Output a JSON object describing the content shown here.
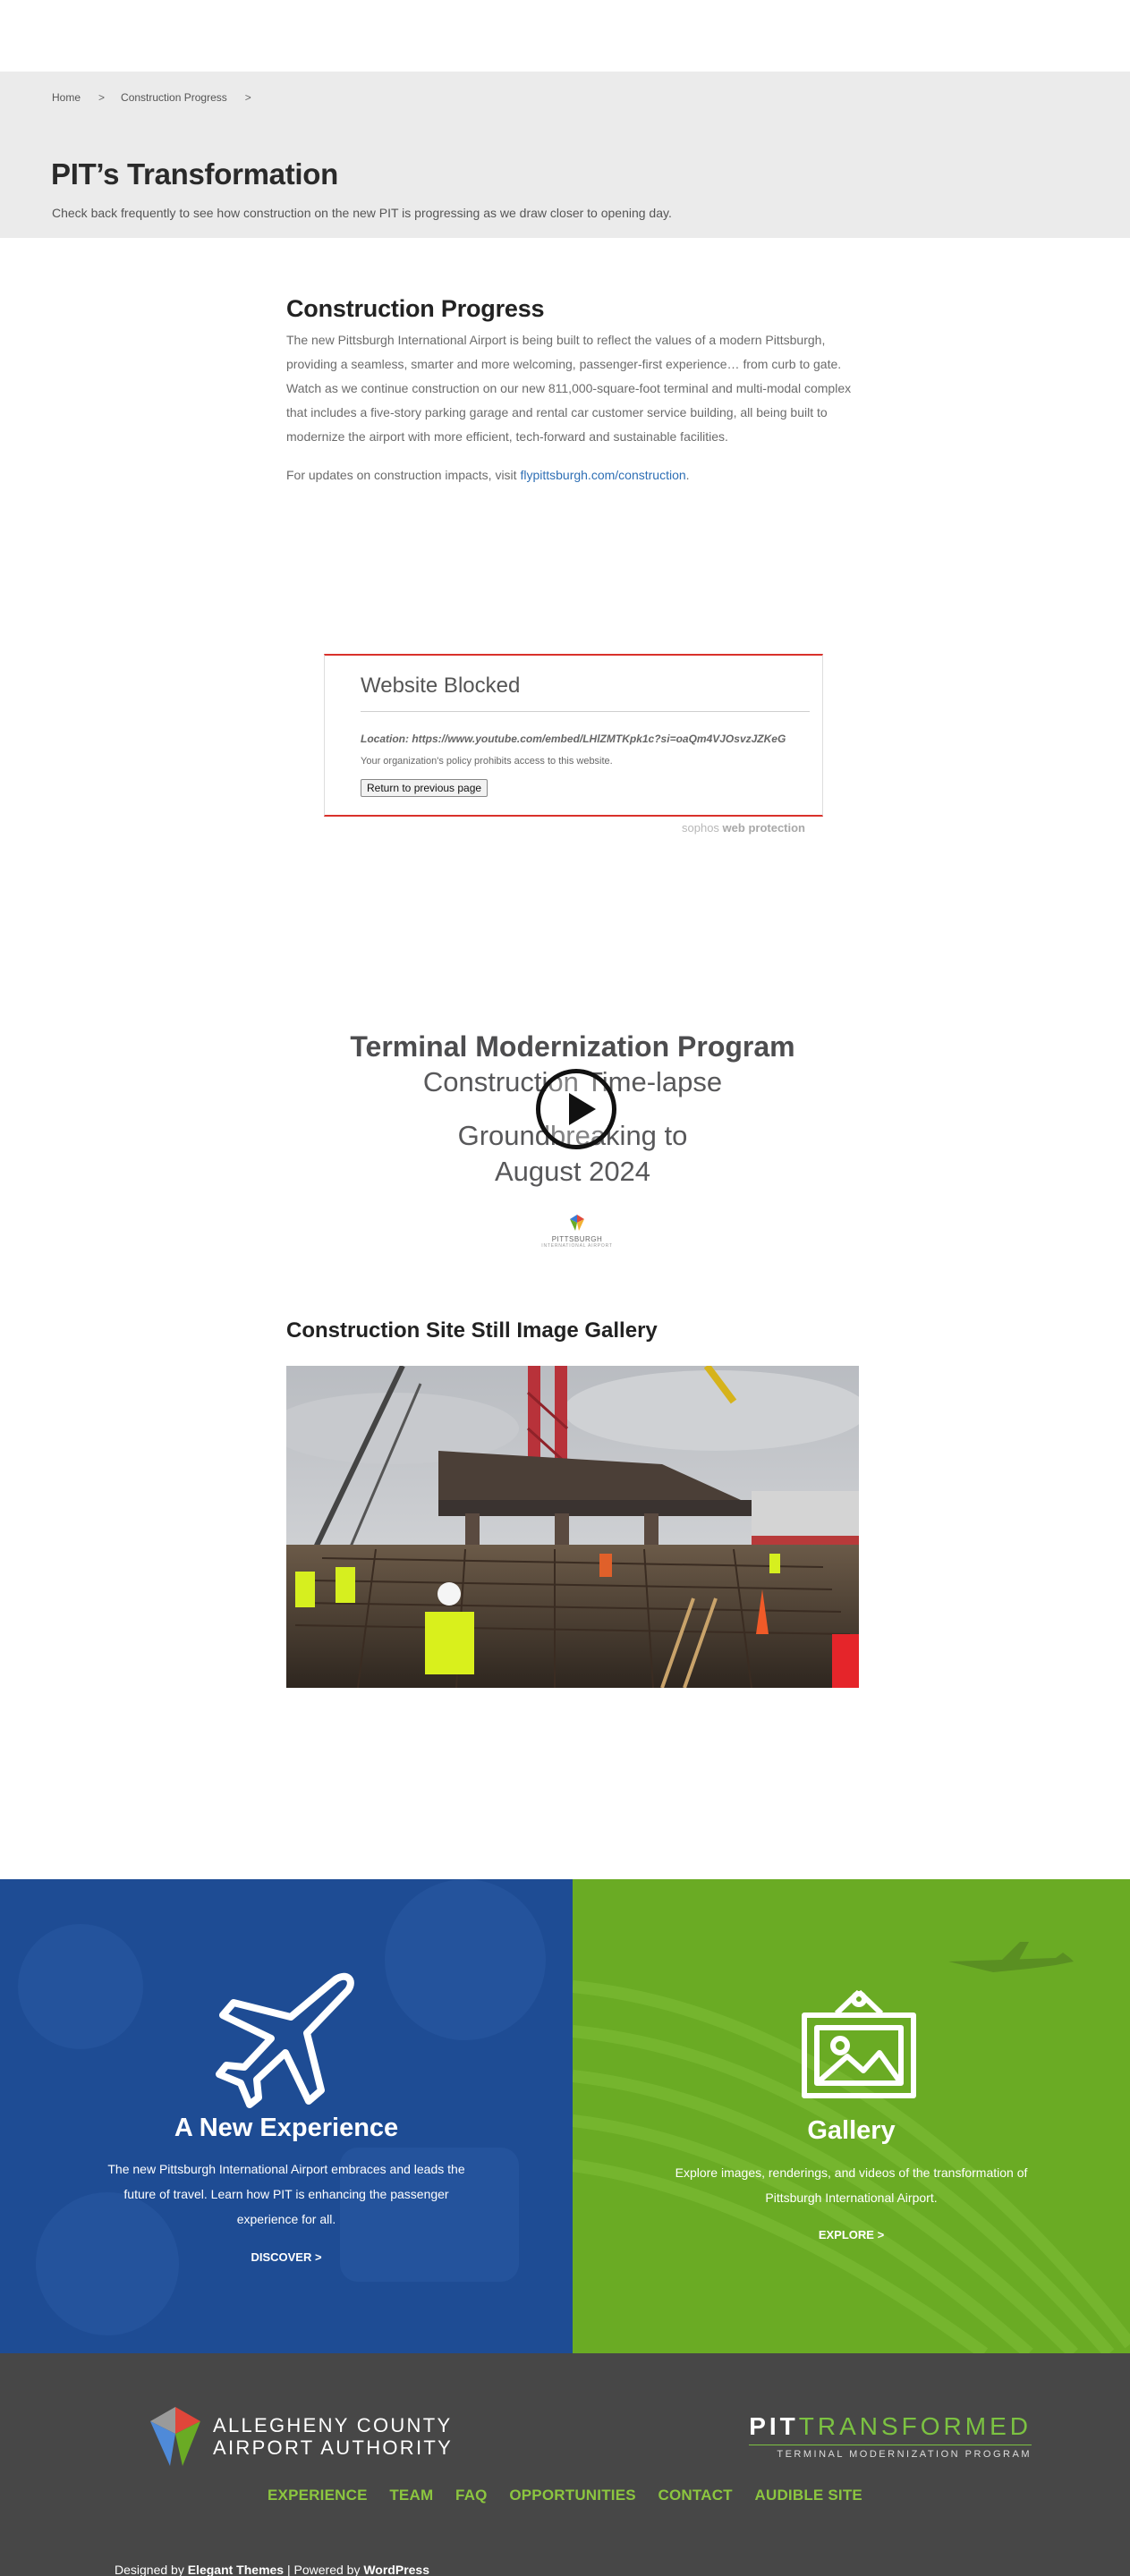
{
  "breadcrumb": {
    "home": "Home",
    "separator": ">",
    "current": "Construction Progress"
  },
  "hero": {
    "title": "PIT’s Transformation",
    "subtitle": "Check back frequently to see how construction on the new PIT is progressing as we draw closer to opening day."
  },
  "main": {
    "title": "Construction Progress",
    "paragraph": "The new Pittsburgh International Airport is being built to reflect the values of a modern Pittsburgh, providing a seamless, smarter and more welcoming, passenger-first experience… from curb to gate. Watch as we continue construction on our new 811,000-square-foot terminal and multi-modal complex that includes a five-story parking garage and rental car customer service building, all being built to modernize the airport with more efficient, tech-forward and sustainable facilities.",
    "updates_prefix": "For updates on construction impacts, visit ",
    "updates_link": "flypittsburgh.com/construction",
    "updates_suffix": "."
  },
  "blocked": {
    "title": "Website Blocked",
    "location": "Location: https://www.youtube.com/embed/LHlZMTKpk1c?si=oaQm4VJOsvzJZKeG",
    "policy": "Your organization's policy prohibits access to this website.",
    "button": "Return to previous page",
    "brand_light": "sophos ",
    "brand_bold": "web protection"
  },
  "video": {
    "title": "Terminal Modernization Program",
    "line1": "Construction Time-lapse",
    "line2": "Groundbreaking to",
    "line3": "August 2024",
    "logo_text": "PITTSBURGH",
    "logo_sub": "INTERNATIONAL AIRPORT"
  },
  "gallery": {
    "title": "Construction Site Still Image Gallery"
  },
  "promo_experience": {
    "title": "A New Experience",
    "desc1": "The new Pittsburgh International Airport embraces and leads the",
    "desc2": "future of travel. Learn how PIT is enhancing the passenger",
    "desc3": "experience for all.",
    "cta": "DISCOVER >"
  },
  "promo_gallery": {
    "title": "Gallery",
    "desc1": "Explore images, renderings, and videos of the transformation of",
    "desc2": "Pittsburgh International Airport.",
    "cta": "EXPLORE >"
  },
  "footer": {
    "acaa_line1": "ALLEGHENY COUNTY",
    "acaa_line2": "AIRPORT AUTHORITY",
    "pit_bold": "PIT",
    "pit_light": "TRANSFORMED",
    "pit_sub": "TERMINAL MODERNIZATION PROGRAM",
    "nav": [
      "EXPERIENCE",
      "TEAM",
      "FAQ",
      "OPPORTUNITIES",
      "CONTACT",
      "AUDIBLE SITE"
    ],
    "credit_prefix": "Designed by ",
    "credit_theme": "Elegant Themes",
    "credit_mid": " | Powered by ",
    "credit_wp": "WordPress"
  },
  "colors": {
    "blue_panel": "#1e4c94",
    "green_panel": "#6aab24",
    "footer_bg": "#474747",
    "footer_link": "#8cc63f",
    "blocked_red": "#d9312b"
  }
}
